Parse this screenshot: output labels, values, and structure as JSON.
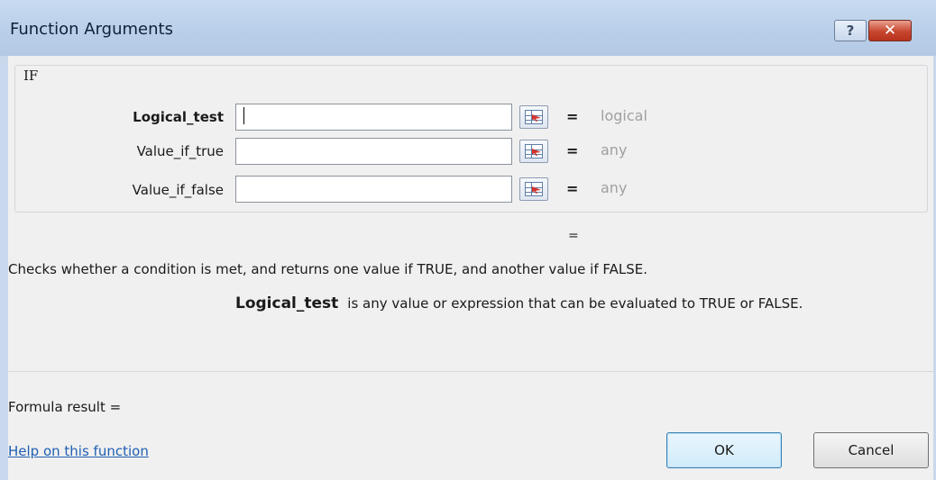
{
  "window": {
    "title": "Function Arguments",
    "help_glyph": "?",
    "close_glyph": "✕"
  },
  "function_name": "IF",
  "arguments": [
    {
      "label": "Logical_test",
      "value": "",
      "type_hint": "logical",
      "equals": "="
    },
    {
      "label": "Value_if_true",
      "value": "",
      "type_hint": "any",
      "equals": "="
    },
    {
      "label": "Value_if_false",
      "value": "",
      "type_hint": "any",
      "equals": "="
    }
  ],
  "result_equals": "=",
  "description": "Checks whether a condition is met, and returns one value if TRUE, and another value if FALSE.",
  "argument_help": {
    "name": "Logical_test",
    "text": "is any value or expression that can be evaluated to TRUE or FALSE."
  },
  "formula_result": "Formula result =",
  "help_link": "Help on this function",
  "buttons": {
    "ok": "OK",
    "cancel": "Cancel"
  },
  "icons": {
    "help": "help-icon",
    "close": "close-icon",
    "range_select": "collapse-dialog-icon"
  }
}
